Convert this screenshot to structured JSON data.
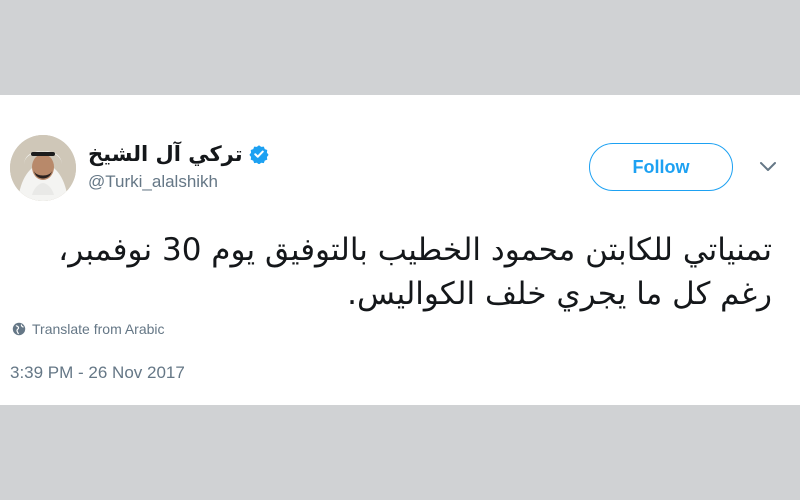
{
  "tweet": {
    "author": {
      "display_name": "تركي آل الشيخ",
      "handle": "@Turki_alalshikh",
      "verified": true,
      "avatar_icon": "user-avatar"
    },
    "follow_label": "Follow",
    "more_icon": "chevron-down-icon",
    "text": "تمنياتي للكابتن محمود الخطيب بالتوفيق يوم 30 نوفمبر، رغم كل ما يجري خلف الكواليس.",
    "translate_label": "Translate from Arabic",
    "translate_icon": "globe-icon",
    "timestamp": "3:39 PM - 26 Nov 2017"
  },
  "colors": {
    "accent": "#1da1f2",
    "secondary_text": "#657786",
    "primary_text": "#14171a",
    "background": "#d0d2d4",
    "card": "#ffffff"
  }
}
